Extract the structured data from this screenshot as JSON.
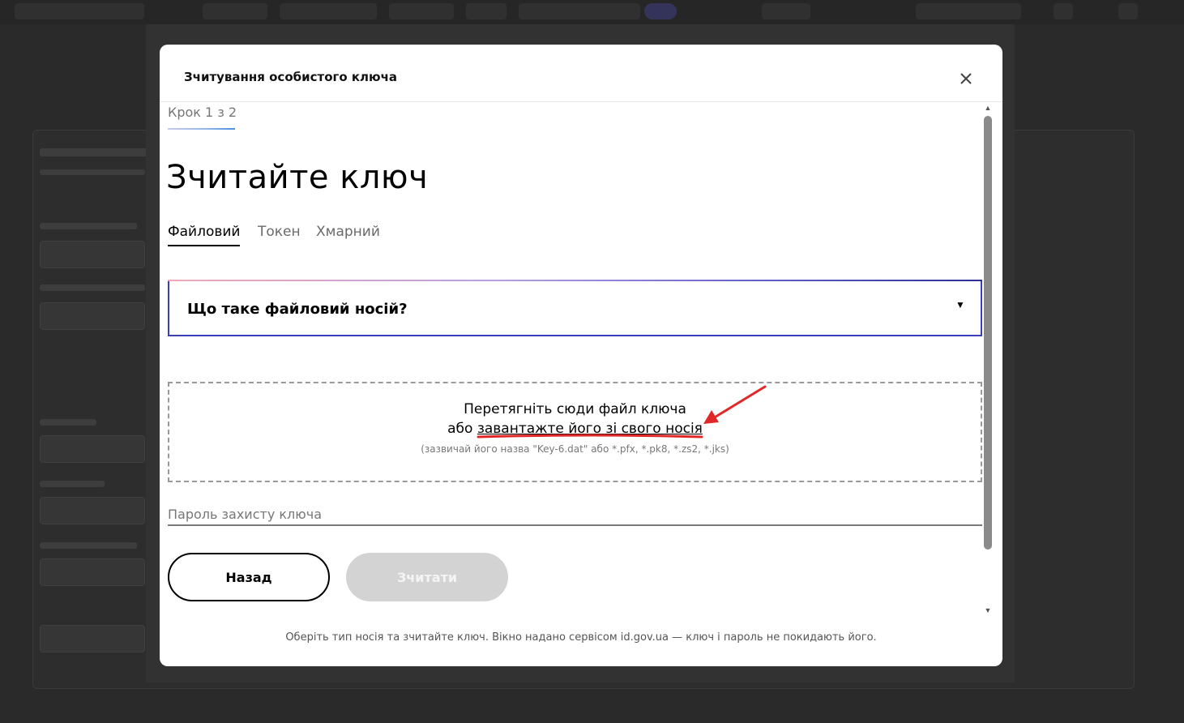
{
  "modal": {
    "title": "Зчитування особистого ключа",
    "close_label": "×"
  },
  "widget": {
    "step": "Крок 1 з 2",
    "heading": "Зчитайте ключ",
    "tabs": [
      {
        "label": "Файловий",
        "active": true
      },
      {
        "label": "Токен",
        "active": false
      },
      {
        "label": "Хмарний",
        "active": false
      }
    ],
    "accordion": {
      "title": "Що таке файловий носій?",
      "icon": "caret-down-icon"
    },
    "dropzone": {
      "line1": "Перетягніть сюди файл ключа",
      "line2_prefix": "або ",
      "line2_link": "завантажте його зі свого носія",
      "hint": "(зазвичай його назва \"Key-6.dat\" або *.pfx, *.pk8, *.zs2, *.jks)"
    },
    "password": {
      "placeholder": "Пароль захисту ключа",
      "value": ""
    },
    "buttons": {
      "back": "Назад",
      "read": "Зчитати"
    }
  },
  "footer": "Оберіть тип носія та зчитайте ключ. Вікно надано сервісом id.gov.ua — ключ і пароль не покидають його.",
  "colors": {
    "accordion_border": "#3a3fb8",
    "annotation_red": "#e02828",
    "disabled_button": "#d3d3d3",
    "overlay": "#1e1e1e"
  }
}
